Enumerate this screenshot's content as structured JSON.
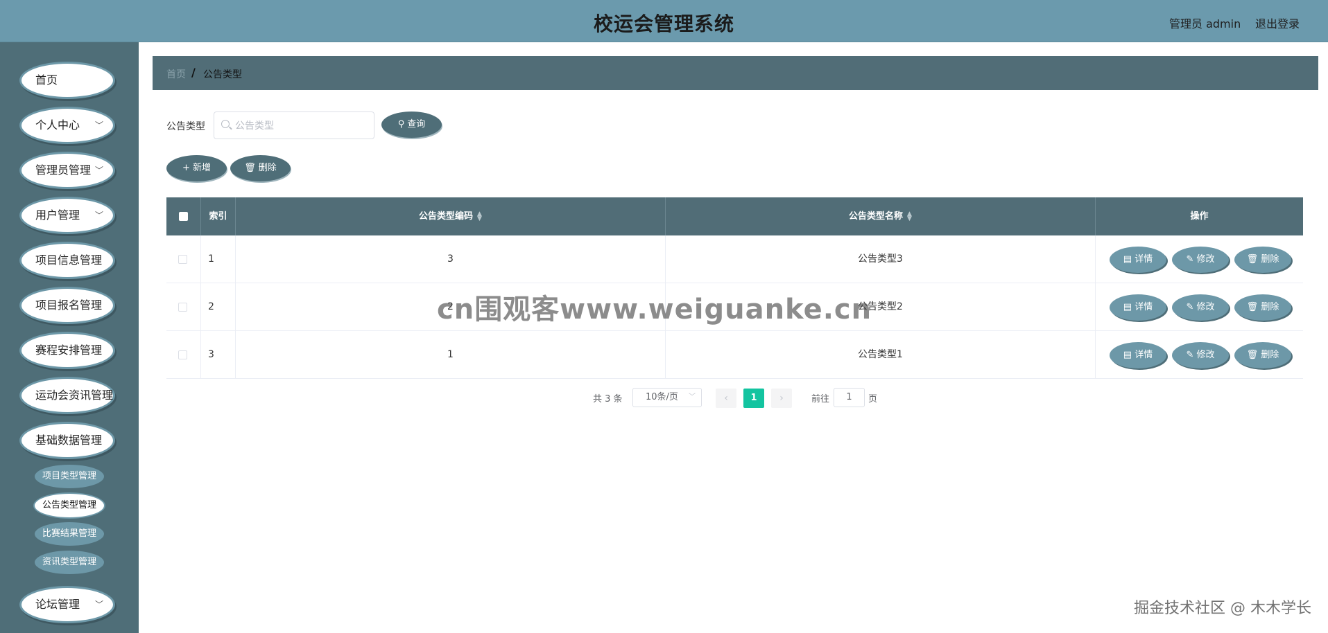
{
  "header": {
    "title": "校运会管理系统",
    "user_label": "管理员 admin",
    "logout_label": "退出登录"
  },
  "sidebar": {
    "items": [
      {
        "label": "首页",
        "has_arrow": false
      },
      {
        "label": "个人中心",
        "has_arrow": true
      },
      {
        "label": "管理员管理",
        "has_arrow": true
      },
      {
        "label": "用户管理",
        "has_arrow": true
      },
      {
        "label": "项目信息管理",
        "has_arrow": false
      },
      {
        "label": "项目报名管理",
        "has_arrow": false
      },
      {
        "label": "赛程安排管理",
        "has_arrow": false
      },
      {
        "label": "运动会资讯管理",
        "has_arrow": false
      },
      {
        "label": "基础数据管理",
        "has_arrow": false
      },
      {
        "label": "论坛管理",
        "has_arrow": true
      }
    ],
    "subitems": [
      {
        "label": "项目类型管理",
        "active": false
      },
      {
        "label": "公告类型管理",
        "active": true
      },
      {
        "label": "比赛结果管理",
        "active": false
      },
      {
        "label": "资讯类型管理",
        "active": false
      }
    ]
  },
  "breadcrumb": {
    "home": "首页",
    "separator": "/",
    "current": "公告类型"
  },
  "search": {
    "label": "公告类型",
    "placeholder": "公告类型",
    "value": "",
    "button_label": "查询"
  },
  "actions": {
    "add_label": "新增",
    "delete_label": "删除"
  },
  "table": {
    "columns": {
      "index": "索引",
      "code": "公告类型编码",
      "name": "公告类型名称",
      "ops": "操作"
    },
    "rows": [
      {
        "index": "1",
        "code": "3",
        "name": "公告类型3"
      },
      {
        "index": "2",
        "code": "2",
        "name": "公告类型2"
      },
      {
        "index": "3",
        "code": "1",
        "name": "公告类型1"
      }
    ],
    "row_actions": {
      "detail": "详情",
      "edit": "修改",
      "delete": "删除"
    }
  },
  "pagination": {
    "total": "共 3 条",
    "page_size": "10条/页",
    "current_page": "1",
    "goto_prefix": "前往",
    "goto_value": "1",
    "goto_suffix": "页"
  },
  "watermarks": {
    "center": "cn围观客www.weiguanke.cn",
    "corner": "掘金技术社区 @ 木木学长"
  },
  "colors": {
    "header_bg": "#6b9aad",
    "sidebar_bg": "#4f6e78",
    "primary": "#516d77",
    "accent": "#6d98a8",
    "page_active": "#13c4a0"
  }
}
